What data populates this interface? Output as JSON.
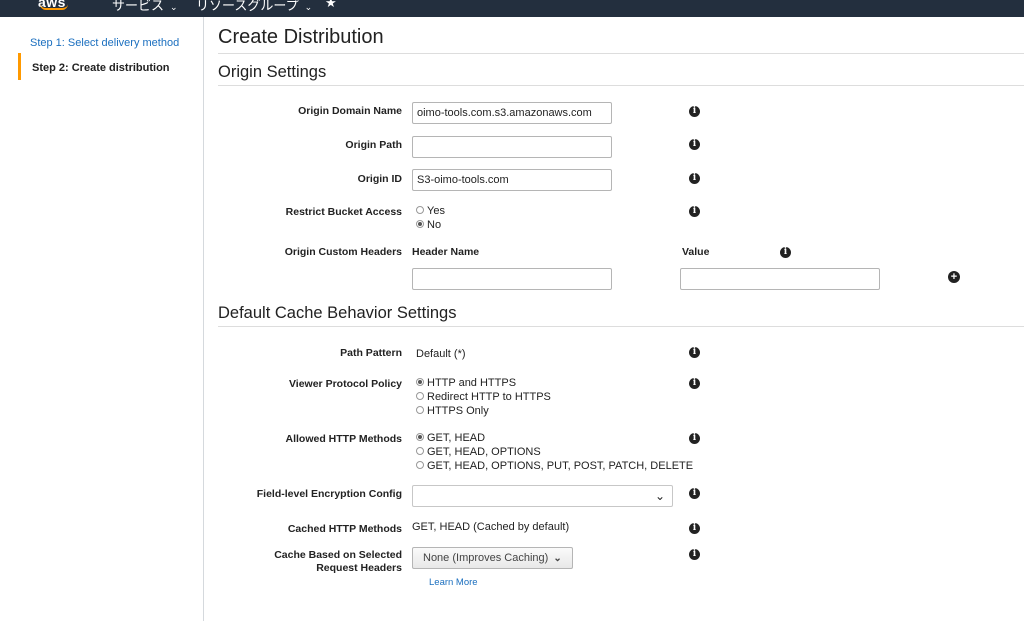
{
  "topbar": {
    "logo": "aws",
    "services_label": "サービス",
    "resource_groups_label": "リソースグループ",
    "caret": "⌄",
    "pin_icon": "★"
  },
  "sidebar": {
    "step1": "Step 1: Select delivery method",
    "step2": "Step 2: Create distribution"
  },
  "page_title": "Create Distribution",
  "origin": {
    "section_title": "Origin Settings",
    "domain_label": "Origin Domain Name",
    "domain_value": "oimo-tools.com.s3.amazonaws.com",
    "path_label": "Origin Path",
    "path_value": "",
    "id_label": "Origin ID",
    "id_value": "S3-oimo-tools.com",
    "restrict_label": "Restrict Bucket Access",
    "restrict_options": [
      "Yes",
      "No"
    ],
    "restrict_selected": "No",
    "custom_headers_label": "Origin Custom Headers",
    "header_name_label": "Header Name",
    "value_label": "Value"
  },
  "cache": {
    "section_title": "Default Cache Behavior Settings",
    "path_pattern_label": "Path Pattern",
    "path_pattern_value": "Default (*)",
    "viewer_label": "Viewer Protocol Policy",
    "viewer_options": [
      "HTTP and HTTPS",
      "Redirect HTTP to HTTPS",
      "HTTPS Only"
    ],
    "viewer_selected": "HTTP and HTTPS",
    "methods_label": "Allowed HTTP Methods",
    "methods_options": [
      "GET, HEAD",
      "GET, HEAD, OPTIONS",
      "GET, HEAD, OPTIONS, PUT, POST, PATCH, DELETE"
    ],
    "methods_selected": "GET, HEAD",
    "fle_label": "Field-level Encryption Config",
    "fle_value": "",
    "cached_label": "Cached HTTP Methods",
    "cached_value": "GET, HEAD (Cached by default)",
    "headers_label_1": "Cache Based on Selected",
    "headers_label_2": "Request Headers",
    "headers_value": "None (Improves Caching)",
    "learn_more": "Learn More"
  },
  "icons": {
    "info": "i",
    "plus": "+",
    "chevron": "⌄"
  }
}
